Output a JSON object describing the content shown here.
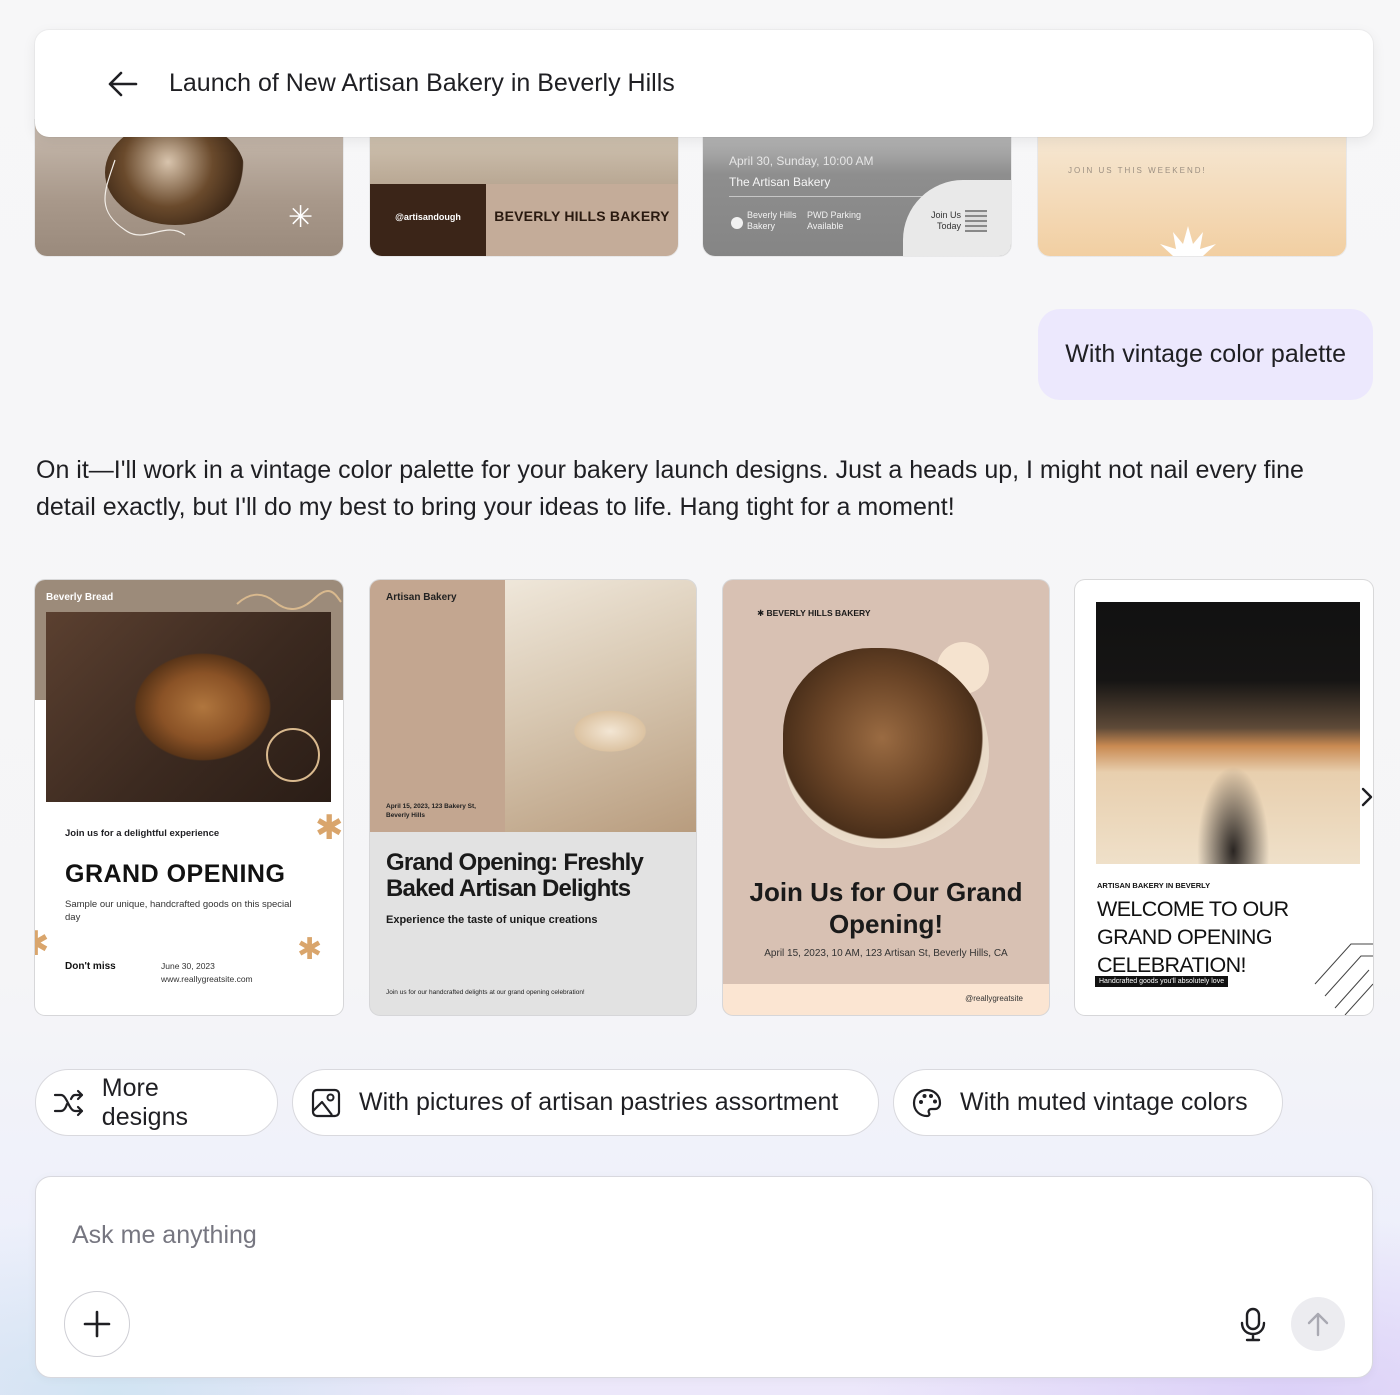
{
  "header": {
    "title": "Launch of New Artisan Bakery in Beverly Hills"
  },
  "prev_designs": {
    "card2": {
      "handle": "@artisandough",
      "name": "BEVERLY HILLS BAKERY"
    },
    "card3": {
      "date": "April 30, Sunday, 10:00 AM",
      "name": "The Artisan Bakery",
      "loc": "Beverly Hills Bakery",
      "parking": "PWD Parking Available",
      "cta": "Join Us Today"
    },
    "card4": {
      "tag": "JOIN US THIS WEEKEND!"
    }
  },
  "user_message": "With vintage color palette",
  "assistant_message": "On it—I'll work in a vintage color palette for your bakery launch designs. Just a heads up, I might not nail every fine detail exactly, but I'll do my best to bring your ideas to life. Hang tight for a moment!",
  "designs": {
    "d1": {
      "brand": "Beverly Bread",
      "tagline": "Join us for a delightful experience",
      "headline": "GRAND OPENING",
      "body": "Sample our unique, handcrafted goods on this special day",
      "dont_miss": "Don't miss",
      "date": "June 30, 2023",
      "site": "www.reallygreatsite.com"
    },
    "d2": {
      "brand": "Artisan Bakery",
      "address": "April 15, 2023, 123 Bakery St, Beverly Hills",
      "headline": "Grand Opening: Freshly Baked Artisan Delights",
      "sub": "Experience the taste of unique creations",
      "footer": "Join us for our handcrafted delights at our grand opening celebration!"
    },
    "d3": {
      "brand": "BEVERLY HILLS BAKERY",
      "headline": "Join Us for Our Grand Opening!",
      "details": "April 15, 2023, 10 AM, 123 Artisan St, Beverly Hills, CA",
      "handle": "@reallygreatsite"
    },
    "d4": {
      "kicker": "ARTISAN BAKERY IN BEVERLY",
      "headline": "WELCOME TO OUR GRAND OPENING CELEBRATION!",
      "tag": "Handcrafted goods you'll absolutely love"
    }
  },
  "suggestions": [
    {
      "label": "More designs",
      "icon": "shuffle-icon"
    },
    {
      "label": "With pictures of artisan pastries assortment",
      "icon": "image-icon"
    },
    {
      "label": "With muted vintage colors",
      "icon": "palette-icon"
    }
  ],
  "composer": {
    "placeholder": "Ask me anything"
  }
}
